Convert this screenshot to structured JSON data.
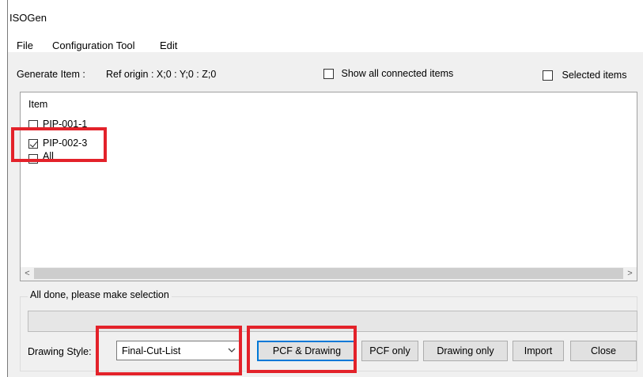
{
  "window": {
    "title": "ISOGen"
  },
  "menu": {
    "items": [
      "File",
      "Configuration Tool",
      "Edit"
    ]
  },
  "generate": {
    "label": "Generate Item :",
    "ref_origin": "Ref origin : X;0 : Y;0 : Z;0",
    "show_all_label": "Show all connected items",
    "show_all_checked": false,
    "selected_items_label": "Selected items",
    "selected_items_checked": false
  },
  "items_list": {
    "header": "Item",
    "rows": [
      {
        "label": "PIP-001-1",
        "checked": false
      },
      {
        "label": "PIP-002-3",
        "checked": true
      },
      {
        "label": "All",
        "checked": false
      }
    ],
    "scroll_left_glyph": "<",
    "scroll_right_glyph": ">"
  },
  "status": {
    "message": "All done, please make selection",
    "progress_fraction": 0
  },
  "drawing_style": {
    "label": "Drawing Style:",
    "selected": "Final-Cut-List"
  },
  "buttons": {
    "pcf_drawing": "PCF & Drawing",
    "pcf_only": "PCF only",
    "drawing_only": "Drawing only",
    "import": "Import",
    "close": "Close"
  },
  "icons": {
    "combo_arrow": "chevron-down-icon",
    "scroll_left": "chevron-left-icon",
    "scroll_right": "chevron-right-icon"
  },
  "colors": {
    "highlight": "#e3222a",
    "default_button_border": "#0078d7"
  }
}
